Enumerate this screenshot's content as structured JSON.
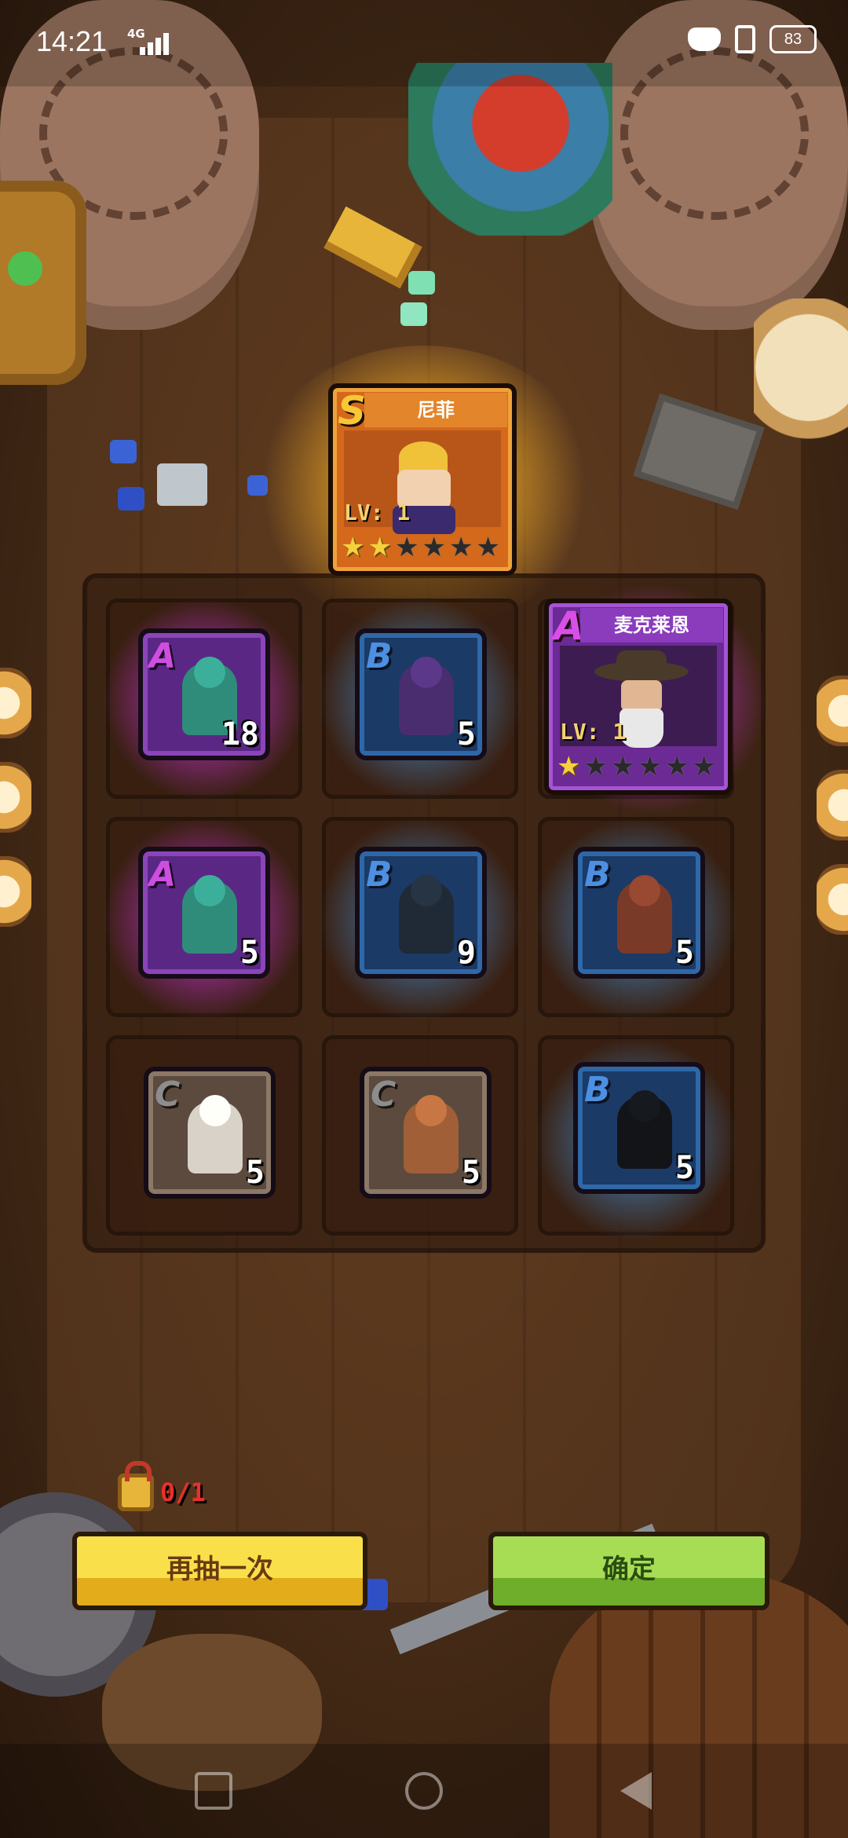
{
  "status_bar": {
    "time": "14:21",
    "network": "4G",
    "battery": "83",
    "icons": [
      "signal-icon",
      "gamepad-icon",
      "vibrate-icon",
      "battery-icon"
    ]
  },
  "hero_s": {
    "grade": "S",
    "name": "尼菲",
    "level": "LV: 1",
    "stars_filled": 2,
    "stars_total": 6
  },
  "hero_a": {
    "grade": "A",
    "name": "麦克莱恩",
    "level": "LV: 1",
    "stars_filled": 1,
    "stars_total": 6
  },
  "tiles": [
    {
      "grade": "A",
      "count": "18"
    },
    {
      "grade": "B",
      "count": "5"
    },
    {
      "grade": "A",
      "count": "5"
    },
    {
      "grade": "B",
      "count": "9"
    },
    {
      "grade": "B",
      "count": "5"
    },
    {
      "grade": "C",
      "count": "5"
    },
    {
      "grade": "C",
      "count": "5"
    },
    {
      "grade": "B",
      "count": "5"
    }
  ],
  "draw_counter": "0/1",
  "buttons": {
    "retry": "再抽一次",
    "confirm": "确定"
  },
  "colors": {
    "grade_s": "#f7c735",
    "grade_a": "#d94ee8",
    "grade_b": "#4d8fe0",
    "grade_c": "#8d8d8d",
    "retry_button": "#f9e04a",
    "confirm_button": "#a7dd55"
  }
}
